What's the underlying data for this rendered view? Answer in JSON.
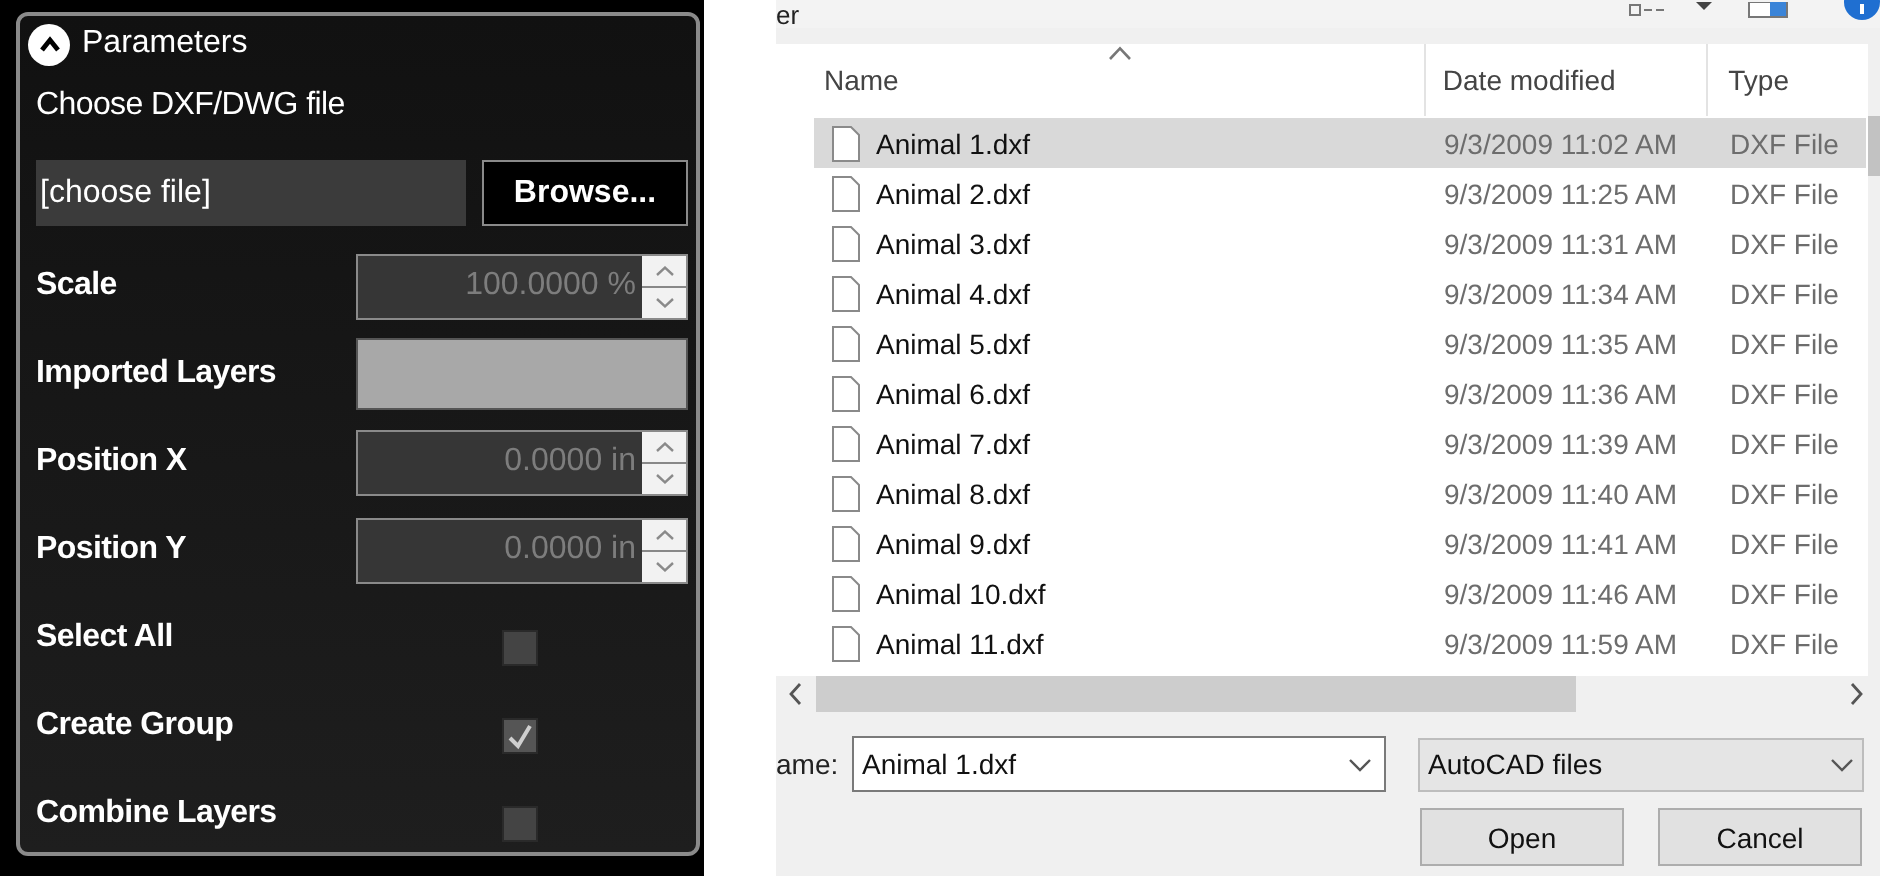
{
  "panel": {
    "title": "Parameters",
    "expanded": true,
    "file_label": "Choose DXF/DWG file",
    "file_field": {
      "placeholder": "[choose file]"
    },
    "browse_button": "Browse...",
    "fields": [
      {
        "kind": "spinner",
        "label": "Scale",
        "value": "100.0000 %",
        "disabled": true
      },
      {
        "kind": "list",
        "label": "Imported Layers"
      },
      {
        "kind": "spinner",
        "label": "Position X",
        "value": "0.0000 in",
        "disabled": true
      },
      {
        "kind": "spinner",
        "label": "Position Y",
        "value": "0.0000 in",
        "disabled": true
      },
      {
        "kind": "checkbox",
        "label": "Select All",
        "checked": false
      },
      {
        "kind": "checkbox",
        "label": "Create Group",
        "checked": true
      },
      {
        "kind": "checkbox",
        "label": "Combine Layers",
        "checked": false
      }
    ]
  },
  "dialog": {
    "cut_title": "er",
    "columns": [
      {
        "label": "Name",
        "sorted": true
      },
      {
        "label": "Date modified",
        "sorted": false
      },
      {
        "label": "Type",
        "sorted": false
      }
    ],
    "rows": [
      {
        "name": "Animal 1.dxf",
        "date": "9/3/2009 11:02 AM",
        "type": "DXF File",
        "selected": true
      },
      {
        "name": "Animal 2.dxf",
        "date": "9/3/2009 11:25 AM",
        "type": "DXF File",
        "selected": false
      },
      {
        "name": "Animal 3.dxf",
        "date": "9/3/2009 11:31 AM",
        "type": "DXF File",
        "selected": false
      },
      {
        "name": "Animal 4.dxf",
        "date": "9/3/2009 11:34 AM",
        "type": "DXF File",
        "selected": false
      },
      {
        "name": "Animal 5.dxf",
        "date": "9/3/2009 11:35 AM",
        "type": "DXF File",
        "selected": false
      },
      {
        "name": "Animal 6.dxf",
        "date": "9/3/2009 11:36 AM",
        "type": "DXF File",
        "selected": false
      },
      {
        "name": "Animal 7.dxf",
        "date": "9/3/2009 11:39 AM",
        "type": "DXF File",
        "selected": false
      },
      {
        "name": "Animal 8.dxf",
        "date": "9/3/2009 11:40 AM",
        "type": "DXF File",
        "selected": false
      },
      {
        "name": "Animal 9.dxf",
        "date": "9/3/2009 11:41 AM",
        "type": "DXF File",
        "selected": false
      },
      {
        "name": "Animal 10.dxf",
        "date": "9/3/2009 11:46 AM",
        "type": "DXF File",
        "selected": false
      },
      {
        "name": "Animal 11.dxf",
        "date": "9/3/2009 11:59 AM",
        "type": "DXF File",
        "selected": false
      }
    ],
    "file_name_label": "ame:",
    "file_name": "Animal 1.dxf",
    "filter": "AutoCAD files",
    "buttons": [
      "Open",
      "Cancel"
    ]
  }
}
